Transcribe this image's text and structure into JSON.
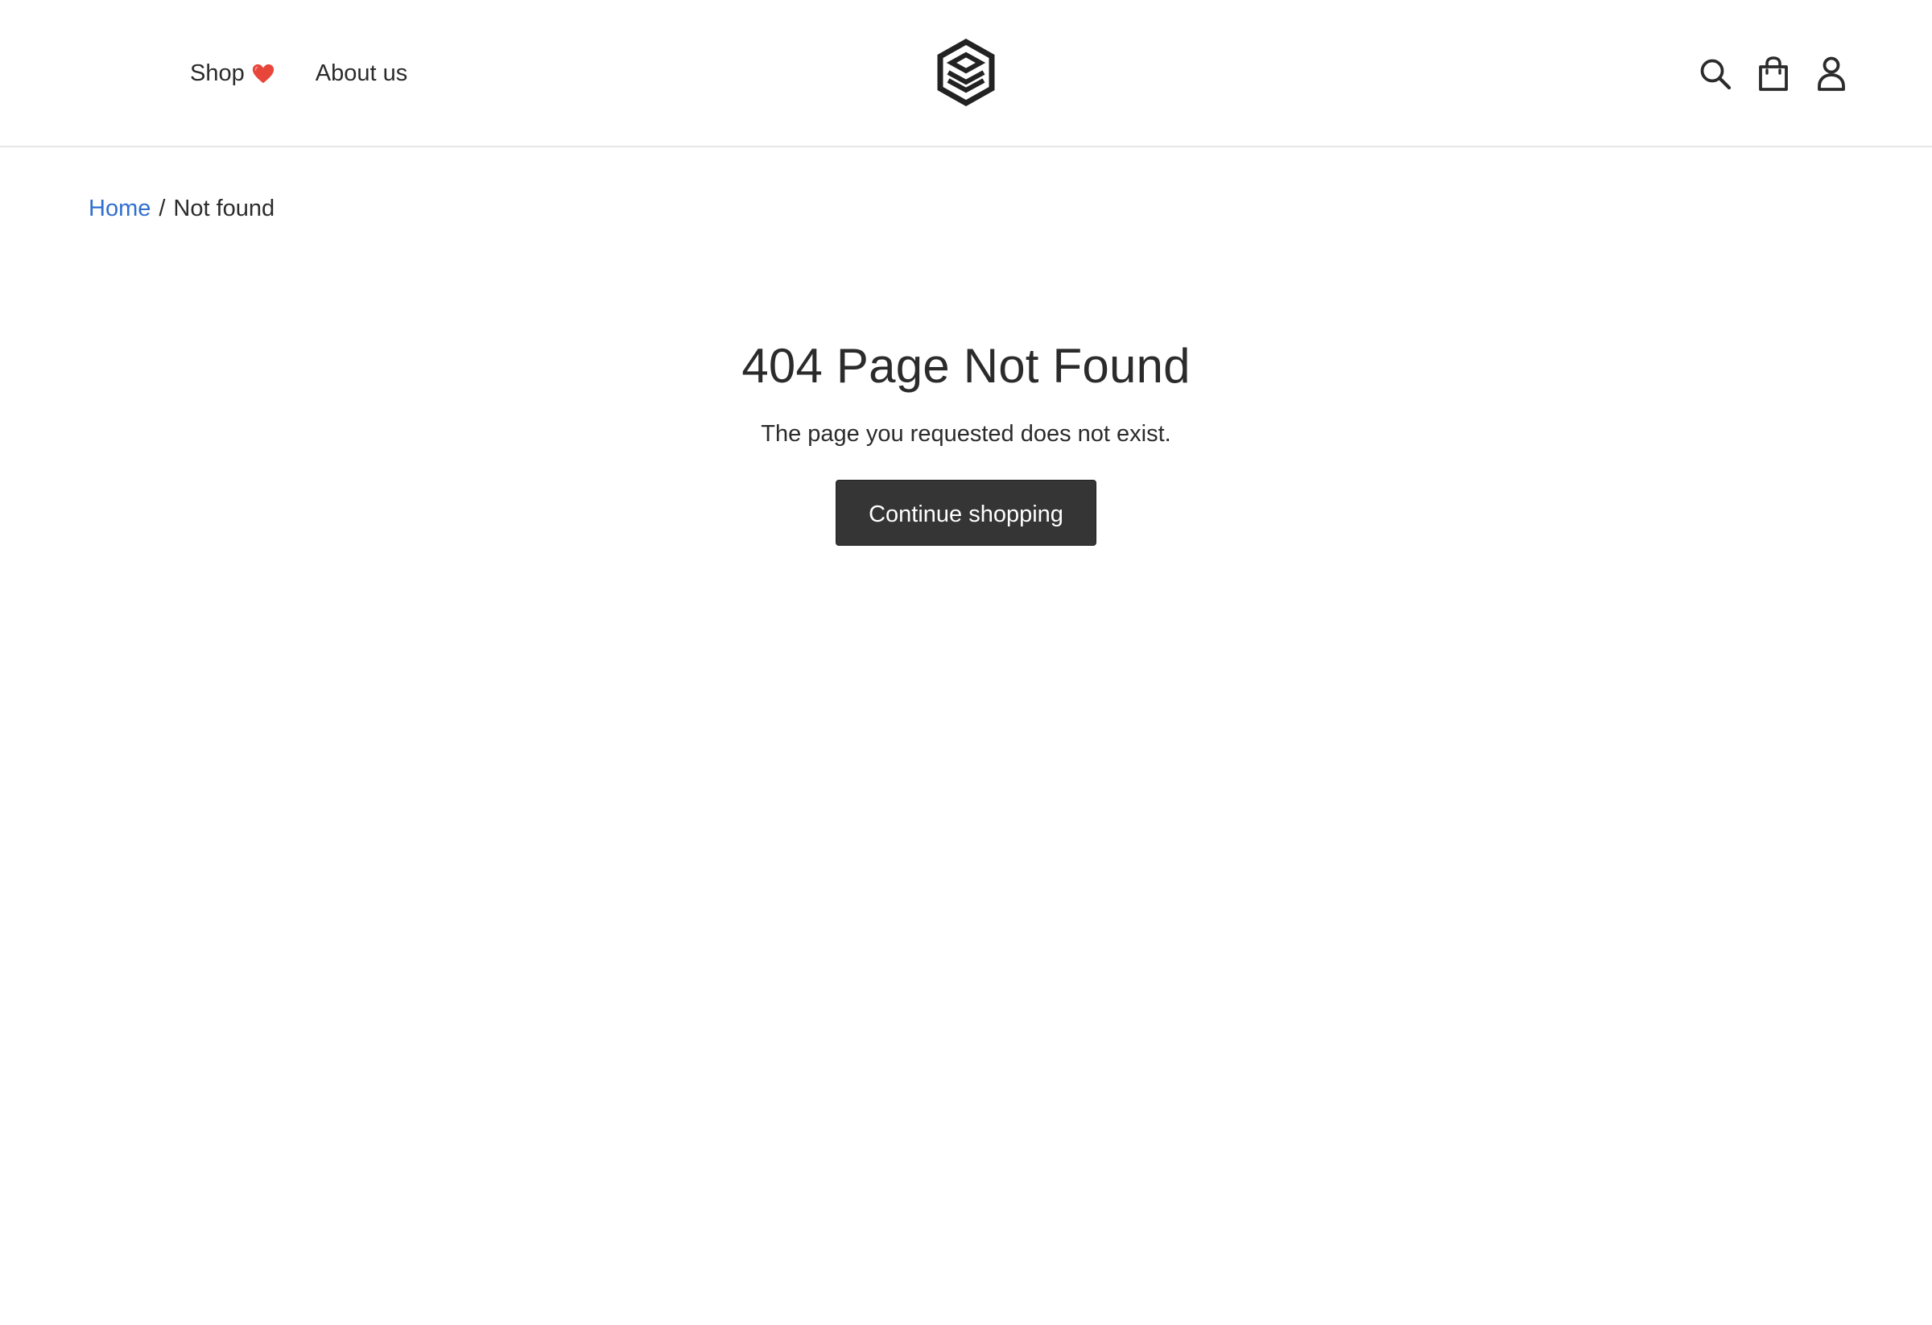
{
  "header": {
    "nav": [
      {
        "label": "Shop",
        "icon": "heart-icon",
        "icon_color": "#e8463a"
      },
      {
        "label": "About us"
      }
    ],
    "logo": "store-logo",
    "icons": [
      "search-icon",
      "shopping-bag-icon",
      "account-icon"
    ]
  },
  "breadcrumb": {
    "home": "Home",
    "separator": "/",
    "current": "Not found"
  },
  "main": {
    "title": "404 Page Not Found",
    "message": "The page you requested does not exist.",
    "button_label": "Continue shopping"
  },
  "colors": {
    "text": "#2b2b2b",
    "link": "#2f6fcf",
    "button_bg": "#353535",
    "button_text": "#ffffff",
    "divider": "#e6e6e6"
  }
}
